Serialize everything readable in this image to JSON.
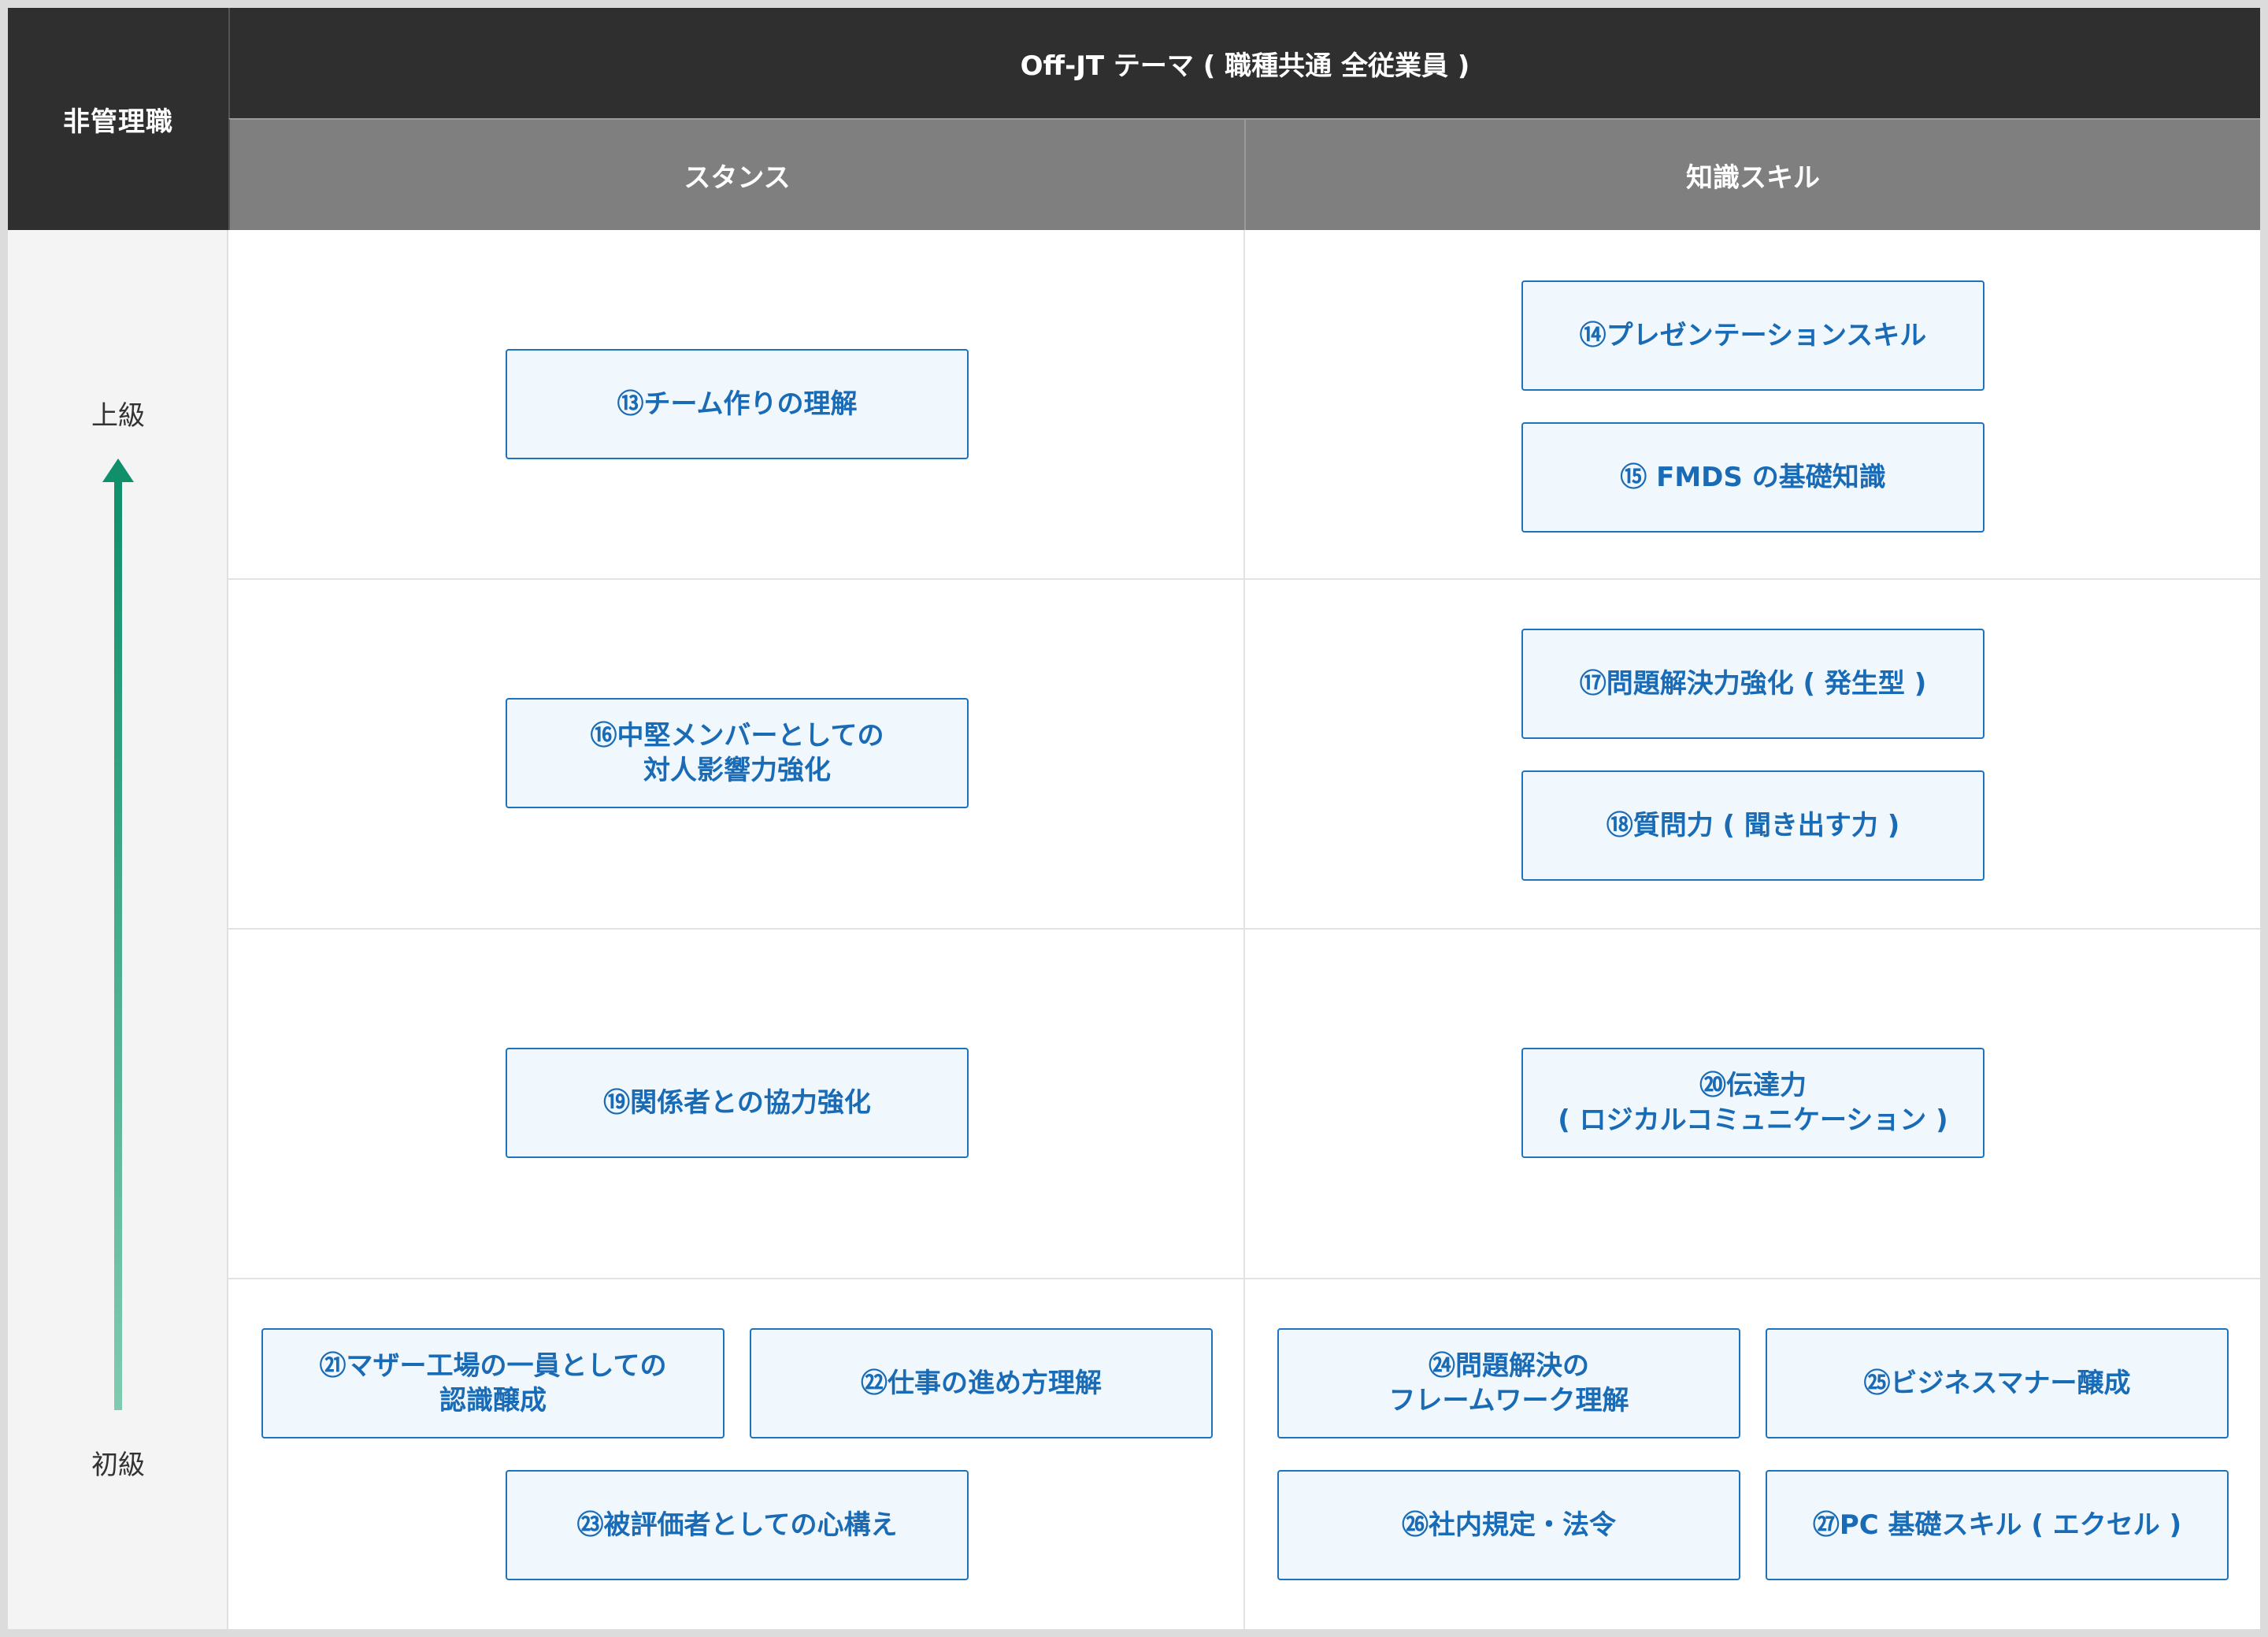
{
  "header": {
    "corner_label": "非管理職",
    "theme_label": "Off-JT テーマ ( 職種共通 全従業員 )",
    "columns": [
      "スタンス",
      "知識スキル"
    ]
  },
  "side": {
    "top_label": "上級",
    "bottom_label": "初級"
  },
  "colors": {
    "header_dark": "#2f2f2f",
    "header_gray": "#7f7f7f",
    "box_border": "#1e73be",
    "box_text": "#1a6bb5",
    "arrow_top": "#0f8f6a",
    "arrow_bottom": "#7fcbb0"
  },
  "courses": {
    "c13": [
      "⑬チーム作りの理解"
    ],
    "c14": [
      "⑭プレゼンテーションスキル"
    ],
    "c15": [
      "⑮ FMDS の基礎知識"
    ],
    "c16": [
      "⑯中堅メンバーとしての",
      "対人影響力強化"
    ],
    "c17": [
      "⑰問題解決力強化 ( 発生型 )"
    ],
    "c18": [
      "⑱質問力 ( 聞き出す力 )"
    ],
    "c19": [
      "⑲関係者との協力強化"
    ],
    "c20": [
      "⑳伝達力",
      "( ロジカルコミュニケーション )"
    ],
    "c21": [
      "㉑マザー工場の一員としての",
      "認識醸成"
    ],
    "c22": [
      "㉒仕事の進め方理解"
    ],
    "c23": [
      "㉓被評価者としての心構え"
    ],
    "c24": [
      "㉔問題解決の",
      "フレームワーク理解"
    ],
    "c25": [
      "㉕ビジネスマナー醸成"
    ],
    "c26": [
      "㉖社内規定・法令"
    ],
    "c27": [
      "㉗PC 基礎スキル ( エクセル )"
    ]
  }
}
